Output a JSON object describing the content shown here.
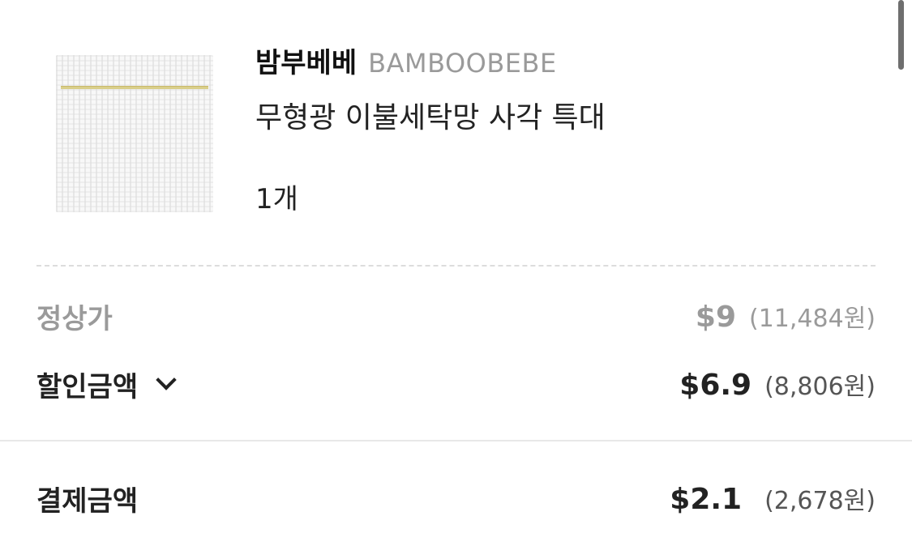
{
  "product": {
    "brand_ko": "밤부베베",
    "brand_en": "BAMBOOBEBE",
    "name": "무형광 이불세탁망 사각 특대",
    "quantity": "1개"
  },
  "price_summary": {
    "regular": {
      "label": "정상가",
      "usd": "$9",
      "krw": "(11,484원)"
    },
    "discount": {
      "label": "할인금액",
      "usd": "$6.9",
      "krw": "(8,806원)"
    },
    "total": {
      "label": "결제금액",
      "usd": "$2.1",
      "krw": "(2,678원)"
    }
  },
  "icons": {
    "discount_toggle": "chevron-down-icon"
  },
  "colors": {
    "muted_text": "#9a9a9a",
    "primary_text": "#222222",
    "divider": "#dcdcdc"
  }
}
